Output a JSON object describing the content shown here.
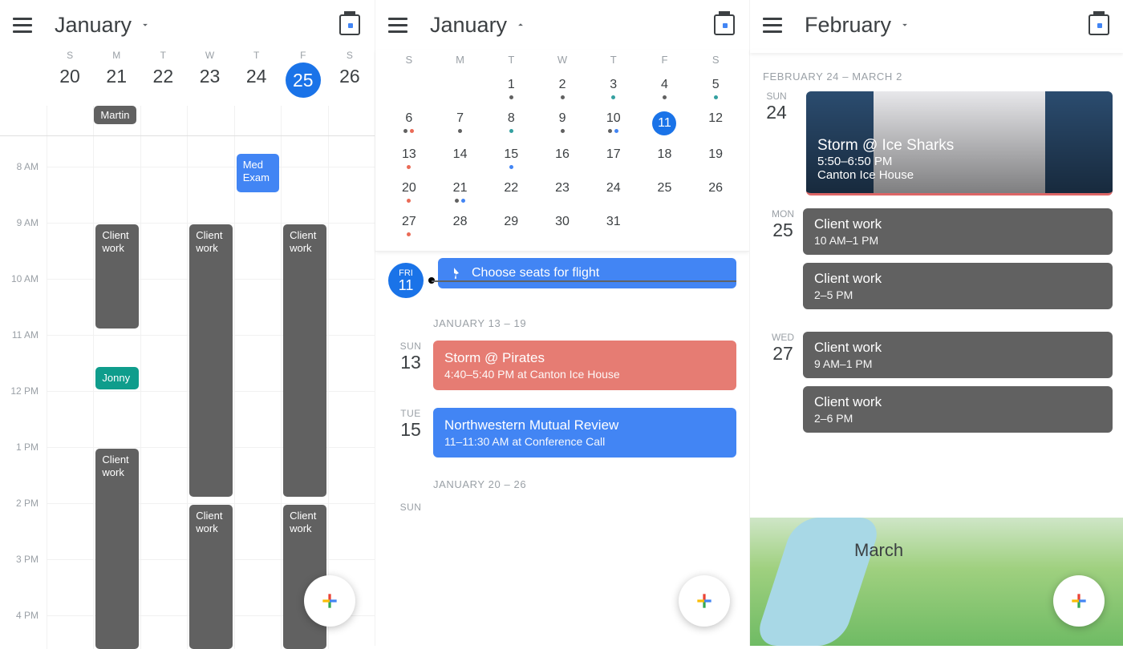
{
  "pane1": {
    "month": "January",
    "days": [
      {
        "dow": "S",
        "dom": "20"
      },
      {
        "dow": "M",
        "dom": "21"
      },
      {
        "dow": "T",
        "dom": "22"
      },
      {
        "dow": "W",
        "dom": "23"
      },
      {
        "dow": "T",
        "dom": "24"
      },
      {
        "dow": "F",
        "dom": "25",
        "today": true
      },
      {
        "dow": "S",
        "dom": "26"
      }
    ],
    "allday": {
      "martin": "Martin"
    },
    "hours": [
      "8 AM",
      "9 AM",
      "10 AM",
      "11 AM",
      "12 PM",
      "1 PM",
      "2 PM",
      "3 PM",
      "4 PM"
    ],
    "events": {
      "med_exam": "Med Exam",
      "client_work": "Client work",
      "jonny": "Jonny"
    }
  },
  "pane2": {
    "month": "January",
    "dows": [
      "S",
      "M",
      "T",
      "W",
      "T",
      "F",
      "S"
    ],
    "grid": [
      [
        "",
        "",
        "1",
        "2",
        "3",
        "4",
        "5"
      ],
      [
        "6",
        "7",
        "8",
        "9",
        "10",
        "11",
        "12"
      ],
      [
        "13",
        "14",
        "15",
        "16",
        "17",
        "18",
        "19"
      ],
      [
        "20",
        "21",
        "22",
        "23",
        "24",
        "25",
        "26"
      ],
      [
        "27",
        "28",
        "29",
        "30",
        "31",
        "",
        ""
      ]
    ],
    "selected": "11",
    "now": {
      "dow": "FRI",
      "dom": "11"
    },
    "task": "Choose seats for flight",
    "sec1": "JANUARY 13 – 19",
    "sun13": {
      "w": "SUN",
      "n": "13",
      "title": "Storm @ Pirates",
      "sub": "4:40–5:40 PM at Canton Ice House"
    },
    "tue15": {
      "w": "TUE",
      "n": "15",
      "title": "Northwestern Mutual Review",
      "sub": "11–11:30 AM at Conference Call"
    },
    "sec2": "JANUARY 20 – 26",
    "sun_lbl": "SUN"
  },
  "pane3": {
    "month": "February",
    "range": "FEBRUARY 24 – MARCH 2",
    "sun24": {
      "w": "SUN",
      "n": "24"
    },
    "hero": {
      "title": "Storm @ Ice Sharks",
      "time": "5:50–6:50 PM",
      "loc": "Canton Ice House"
    },
    "mon25": {
      "w": "MON",
      "n": "25",
      "cards": [
        {
          "t": "Client work",
          "s": "10 AM–1 PM"
        },
        {
          "t": "Client work",
          "s": "2–5 PM"
        }
      ]
    },
    "wed27": {
      "w": "WED",
      "n": "27",
      "cards": [
        {
          "t": "Client work",
          "s": "9 AM–1 PM"
        },
        {
          "t": "Client work",
          "s": "2–6 PM"
        }
      ]
    },
    "month_art": "March"
  }
}
